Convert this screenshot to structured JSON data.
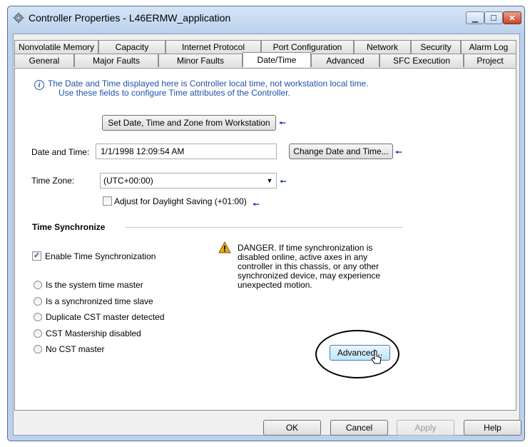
{
  "window": {
    "title": "Controller Properties - L46ERMW_application",
    "icon": "gear-icon",
    "controls": {
      "minimize": "▁",
      "maximize": "☐",
      "close": "✕"
    }
  },
  "tabs_row1": [
    {
      "label": "Nonvolatile Memory"
    },
    {
      "label": "Capacity"
    },
    {
      "label": "Internet Protocol"
    },
    {
      "label": "Port Configuration"
    },
    {
      "label": "Network"
    },
    {
      "label": "Security"
    },
    {
      "label": "Alarm Log"
    }
  ],
  "tabs_row2": [
    {
      "label": "General"
    },
    {
      "label": "Major Faults"
    },
    {
      "label": "Minor Faults"
    },
    {
      "label": "Date/Time",
      "active": true
    },
    {
      "label": "Advanced"
    },
    {
      "label": "SFC Execution"
    },
    {
      "label": "Project"
    }
  ],
  "info": {
    "line1": "The Date and Time displayed here is Controller local time, not workstation local time.",
    "line2": "Use these fields to configure Time attributes of the Controller."
  },
  "set_from_workstation_label": "Set Date, Time and Zone from Workstation",
  "date_time": {
    "label": "Date and Time:",
    "value": "1/1/1998 12:09:54 AM",
    "change_label": "Change Date and Time..."
  },
  "time_zone": {
    "label": "Time Zone:",
    "selected": "(UTC+00:00)"
  },
  "daylight_saving": {
    "label": "Adjust for Daylight Saving (+01:00)",
    "checked": false
  },
  "time_sync": {
    "title": "Time Synchronize",
    "enable_label": "Enable Time Synchronization",
    "enable_checked": true,
    "check_mark": "✓",
    "options": [
      "Is the system time master",
      "Is a synchronized time slave",
      "Duplicate CST master detected",
      "CST Mastership disabled",
      "No CST master"
    ],
    "danger_text": "DANGER. If time synchronization is disabled online, active axes in any controller in this chassis, or any other synchronized device, may experience unexpected motion.",
    "advanced_label": "Advanced..."
  },
  "arrow_glyph": "🠔",
  "footer": {
    "ok": "OK",
    "cancel": "Cancel",
    "apply": "Apply",
    "help": "Help"
  },
  "colors": {
    "info_text": "#1f52ad",
    "arrow": "#1f3fa8",
    "warning": "#e8a81c"
  }
}
